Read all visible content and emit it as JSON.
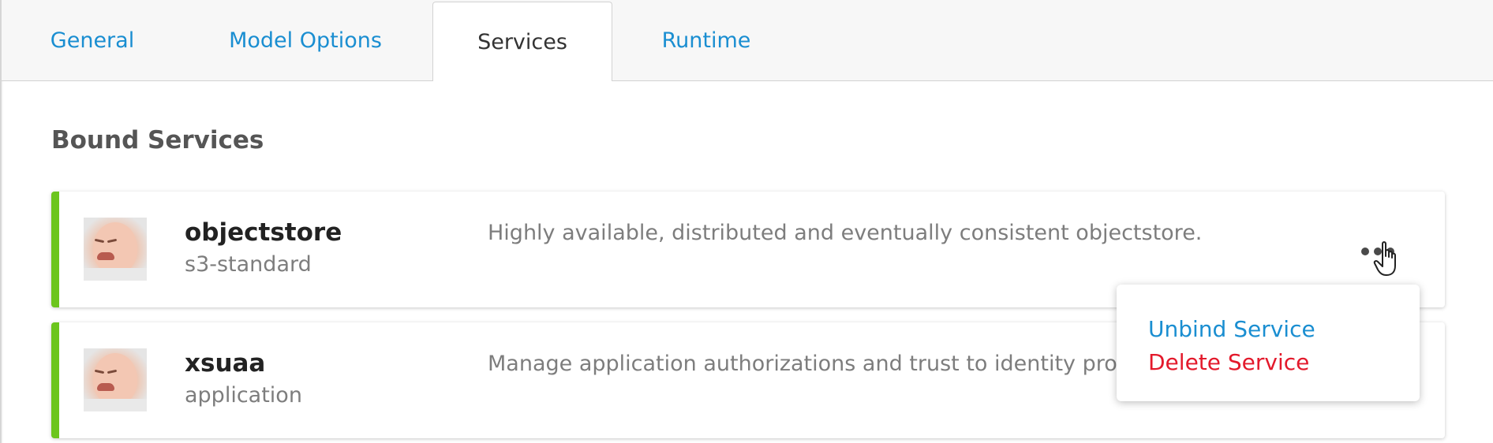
{
  "tabs": {
    "general": "General",
    "model_options": "Model Options",
    "services": "Services",
    "runtime": "Runtime",
    "active": "Services"
  },
  "section": {
    "title": "Bound Services"
  },
  "services": [
    {
      "name": "objectstore",
      "plan": "s3-standard",
      "description": "Highly available, distributed and eventually consistent objectstore."
    },
    {
      "name": "xsuaa",
      "plan": "application",
      "description": "Manage application authorizations and trust to identity provic"
    }
  ],
  "menu": {
    "unbind": "Unbind Service",
    "delete": "Delete Service"
  },
  "colors": {
    "accent": "#1a8ed1",
    "danger": "#e3192b",
    "status_bar": "#6cc51d"
  },
  "icons": {
    "more": "more-horizontal-icon",
    "cursor": "hand-pointer-icon"
  }
}
